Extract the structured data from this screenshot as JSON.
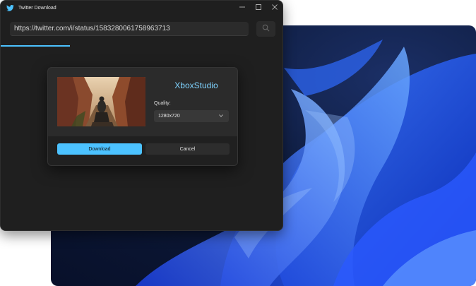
{
  "window": {
    "title": "Twitter Download",
    "icon": "twitter-bird-icon"
  },
  "controls": {
    "minimize_icon": "minimize-icon",
    "maximize_icon": "maximize-icon",
    "close_icon": "close-icon"
  },
  "url_bar": {
    "value": "https://twitter.com/i/status/1583280061758963713",
    "search_icon": "search-icon"
  },
  "progress": {
    "fraction": 0.245
  },
  "dialog": {
    "title": "XboxStudio",
    "quality_label": "Quality:",
    "quality_value": "1280x720",
    "download_label": "Download",
    "cancel_label": "Cancel"
  },
  "colors": {
    "accent": "#4cc2ff",
    "window_bg": "#1f1f1f",
    "dialog_bg": "#2b2b2b",
    "title_text": "#7fd3ff"
  }
}
